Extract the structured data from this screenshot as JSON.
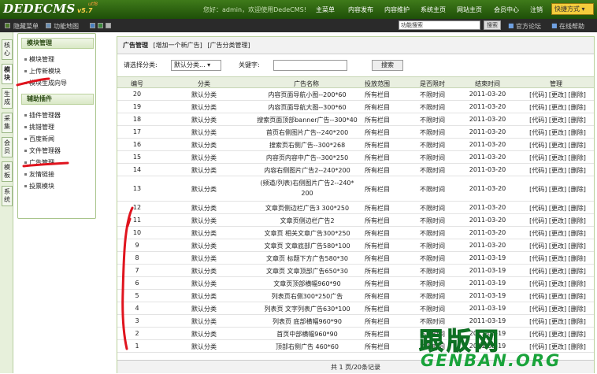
{
  "app": {
    "logo": "DEDECMS",
    "version": "v5.7",
    "tag": "utf8",
    "welcome": "您好：admin，欢迎使用DedeCMS!"
  },
  "top_nav": [
    "主菜单",
    "内容发布",
    "内容维护",
    "系统主页",
    "网站主页",
    "会员中心",
    "注销"
  ],
  "quick_menu": "快捷方式 ▾",
  "sub_bar": {
    "hide_menu": "隐藏菜单",
    "site_map": "功能地图",
    "search_placeholder": "功能搜索",
    "search_button": "搜索",
    "forum": "官方论坛",
    "help": "在线帮助"
  },
  "side_tabs": [
    "核心",
    "模块",
    "生成",
    "采集",
    "会员",
    "模板",
    "系统"
  ],
  "left_panel": {
    "sections": [
      {
        "title": "模块管理",
        "items": [
          "模块管理",
          "上传新模块",
          "模块生成向导"
        ]
      },
      {
        "title": "辅助插件",
        "items": [
          "插件管理器",
          "挑错管理",
          "百度新闻",
          "文件管理器",
          "广告管理",
          "友情链接",
          "投票模块"
        ]
      }
    ]
  },
  "content": {
    "title": "广告管理",
    "links": [
      "[增加一个新广告]",
      "[广告分类管理]"
    ],
    "filter": {
      "cat_label": "请选择分类:",
      "cat_value": "默认分类... ▾",
      "kw_label": "关键字:",
      "kw_value": "",
      "search_button": "搜索"
    },
    "columns": [
      "编号",
      "分类",
      "广告名称",
      "投放范围",
      "是否限时",
      "结束时间",
      "管理"
    ],
    "rows": [
      {
        "id": "20",
        "cat": "默认分类",
        "name": "内容页面导航小图--200*60",
        "scope": "所有栏目",
        "timed": "不限时间",
        "end": "2011-03-20",
        "ops": "[代码] [更改] [删除]"
      },
      {
        "id": "19",
        "cat": "默认分类",
        "name": "内容页面导航大图--300*60",
        "scope": "所有栏目",
        "timed": "不限时间",
        "end": "2011-03-20",
        "ops": "[代码] [更改] [删除]"
      },
      {
        "id": "18",
        "cat": "默认分类",
        "name": "搜索页面顶部banner广告--300*40",
        "scope": "所有栏目",
        "timed": "不限时间",
        "end": "2011-03-20",
        "ops": "[代码] [更改] [删除]"
      },
      {
        "id": "17",
        "cat": "默认分类",
        "name": "首页右侧图片广告--240*200",
        "scope": "所有栏目",
        "timed": "不限时间",
        "end": "2011-03-20",
        "ops": "[代码] [更改] [删除]"
      },
      {
        "id": "16",
        "cat": "默认分类",
        "name": "搜索页右侧广告--300*268",
        "scope": "所有栏目",
        "timed": "不限时间",
        "end": "2011-03-20",
        "ops": "[代码] [更改] [删除]"
      },
      {
        "id": "15",
        "cat": "默认分类",
        "name": "内容页内容中广告--300*250",
        "scope": "所有栏目",
        "timed": "不限时间",
        "end": "2011-03-20",
        "ops": "[代码] [更改] [删除]"
      },
      {
        "id": "14",
        "cat": "默认分类",
        "name": "内容右侧图片广告2--240*200",
        "scope": "所有栏目",
        "timed": "不限时间",
        "end": "2011-03-20",
        "ops": "[代码] [更改] [删除]"
      },
      {
        "id": "13",
        "cat": "默认分类",
        "name": "(频道/列表)右侧图片广告2--240*",
        "name2": "200",
        "scope": "所有栏目",
        "timed": "不限时间",
        "end": "2011-03-20",
        "ops": "[代码] [更改] [删除]"
      },
      {
        "id": "12",
        "cat": "默认分类",
        "name": "文章页侧边栏广告3 300*250",
        "scope": "所有栏目",
        "timed": "不限时间",
        "end": "2011-03-20",
        "ops": "[代码] [更改] [删除]"
      },
      {
        "id": "11",
        "cat": "默认分类",
        "name": "文章页侧边栏广告2",
        "scope": "所有栏目",
        "timed": "不限时间",
        "end": "2011-03-20",
        "ops": "[代码] [更改] [删除]"
      },
      {
        "id": "10",
        "cat": "默认分类",
        "name": "文章页 相关文章广告300*250",
        "scope": "所有栏目",
        "timed": "不限时间",
        "end": "2011-03-20",
        "ops": "[代码] [更改] [删除]"
      },
      {
        "id": "9",
        "cat": "默认分类",
        "name": "文章页 文章底部广告580*100",
        "scope": "所有栏目",
        "timed": "不限时间",
        "end": "2011-03-20",
        "ops": "[代码] [更改] [删除]"
      },
      {
        "id": "8",
        "cat": "默认分类",
        "name": "文章页 标题下方广告580*30",
        "scope": "所有栏目",
        "timed": "不限时间",
        "end": "2011-03-19",
        "ops": "[代码] [更改] [删除]"
      },
      {
        "id": "7",
        "cat": "默认分类",
        "name": "文章页 文章顶部广告650*30",
        "scope": "所有栏目",
        "timed": "不限时间",
        "end": "2011-03-19",
        "ops": "[代码] [更改] [删除]"
      },
      {
        "id": "6",
        "cat": "默认分类",
        "name": "文章页顶部横幅960*90",
        "scope": "所有栏目",
        "timed": "不限时间",
        "end": "2011-03-19",
        "ops": "[代码] [更改] [删除]"
      },
      {
        "id": "5",
        "cat": "默认分类",
        "name": "列表页右侧300*250广告",
        "scope": "所有栏目",
        "timed": "不限时间",
        "end": "2011-03-19",
        "ops": "[代码] [更改] [删除]"
      },
      {
        "id": "4",
        "cat": "默认分类",
        "name": "列表页 文字列表广告630*100",
        "scope": "所有栏目",
        "timed": "不限时间",
        "end": "2011-03-19",
        "ops": "[代码] [更改] [删除]"
      },
      {
        "id": "3",
        "cat": "默认分类",
        "name": "列表页 底部横幅960*90",
        "scope": "所有栏目",
        "timed": "不限时间",
        "end": "2011-03-19",
        "ops": "[代码] [更改] [删除]"
      },
      {
        "id": "2",
        "cat": "默认分类",
        "name": "首页中部横幅960*90",
        "scope": "所有栏目",
        "timed": "不限时间",
        "end": "2011-03-19",
        "ops": "[代码] [更改] [删除]"
      },
      {
        "id": "1",
        "cat": "默认分类",
        "name": "顶部右侧广告 460*60",
        "scope": "所有栏目",
        "timed": "不限时间",
        "end": "2011-03-19",
        "ops": "[代码] [更改] [删除]"
      }
    ],
    "footer": "共 1 页/20条记录"
  },
  "watermark": {
    "top": "跟版网",
    "bottom": "GENBAN.ORG"
  },
  "colors": {
    "top_bar": "#2f6612",
    "accent": "#f4cc3c",
    "annotation": "#e0141e",
    "watermark": "#19a33a"
  }
}
